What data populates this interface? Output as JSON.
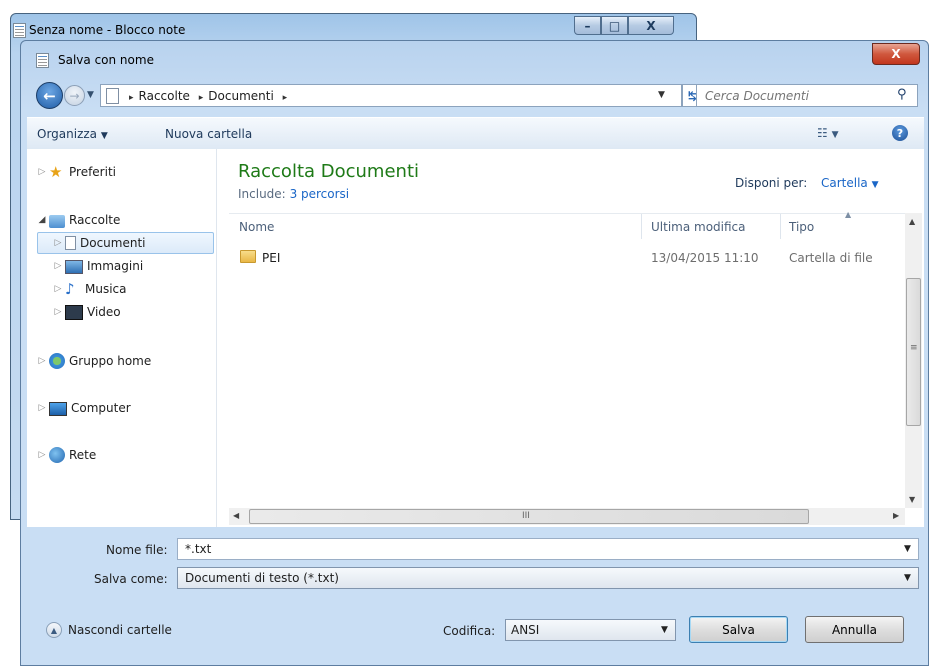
{
  "background_window": {
    "title": "Senza nome - Blocco note",
    "minimize": "–",
    "maximize": "□",
    "close": "X"
  },
  "dialog": {
    "title": "Salva con nome",
    "close": "X"
  },
  "address_bar": {
    "breadcrumbs": [
      "Raccolte",
      "Documenti"
    ],
    "separator": "▸",
    "search_placeholder": "Cerca Documenti"
  },
  "toolbar": {
    "organize": "Organizza",
    "new_folder": "Nuova cartella"
  },
  "nav_pane": {
    "favorites": "Preferiti",
    "libraries": "Raccolte",
    "library_items": [
      "Documenti",
      "Immagini",
      "Musica",
      "Video"
    ],
    "homegroup": "Gruppo home",
    "computer": "Computer",
    "network": "Rete"
  },
  "library": {
    "title": "Raccolta Documenti",
    "includes_label": "Include:",
    "includes_link": "3 percorsi",
    "arrange_label": "Disponi per:",
    "arrange_value": "Cartella"
  },
  "columns": {
    "name": "Nome",
    "modified": "Ultima modifica",
    "type": "Tipo"
  },
  "files": [
    {
      "name": "PEI",
      "modified": "13/04/2015 11:10",
      "type": "Cartella di file"
    }
  ],
  "form": {
    "filename_label": "Nome file:",
    "filename_value": "*.txt",
    "saveas_label": "Salva come:",
    "saveas_value": "Documenti di testo (*.txt)",
    "encoding_label": "Codifica:",
    "encoding_value": "ANSI"
  },
  "buttons": {
    "hide_folders": "Nascondi cartelle",
    "save": "Salva",
    "cancel": "Annulla"
  },
  "scrollbar": {
    "grip": "III",
    "vgrip": "≡"
  },
  "colors": {
    "accent_green": "#1e7a17",
    "link_blue": "#1a66c7",
    "selection": "#dceaf9"
  }
}
